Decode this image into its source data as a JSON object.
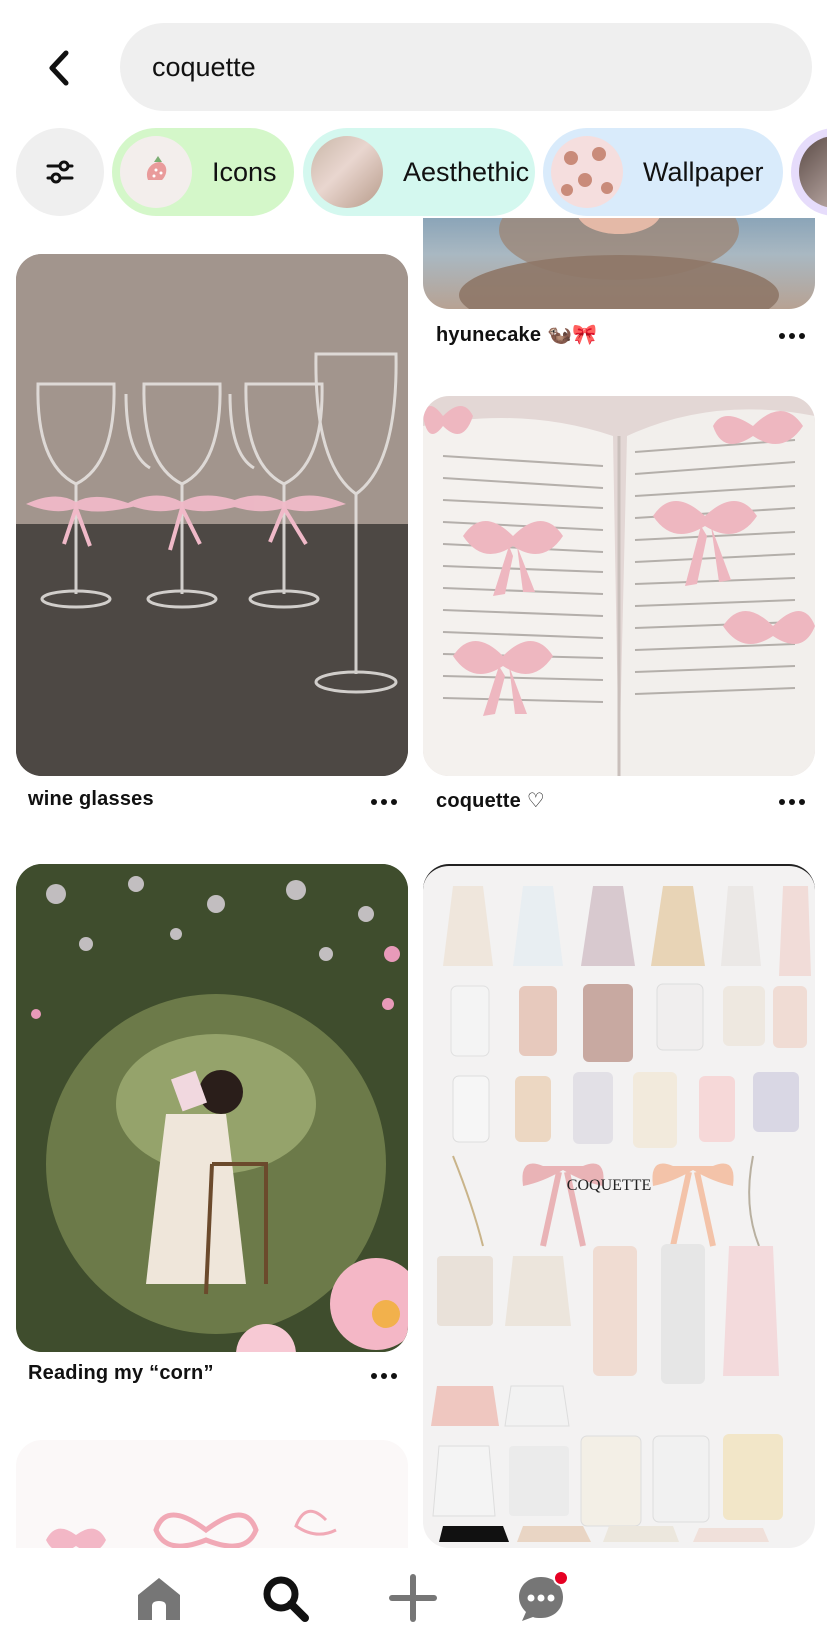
{
  "search": {
    "query": "coquette"
  },
  "chips": [
    {
      "label": "Icons",
      "bg": "#d4f7c9"
    },
    {
      "label": "Aesthethic",
      "bg": "#d4f8ef"
    },
    {
      "label": "Wallpaper",
      "bg": "#d9ebfb"
    }
  ],
  "pins": [
    {
      "title": "hyunecake 🦦🎀"
    },
    {
      "title": "wine glasses"
    },
    {
      "title": "coquette ♡"
    },
    {
      "title": "Reading my “corn”"
    }
  ],
  "collage_text": "COQUETTE",
  "colors": {
    "accent": "#e60023",
    "chip_bg": "#efefef"
  },
  "icons": {
    "back": "chevron-left-icon",
    "filter": "sliders-icon",
    "home": "home-icon",
    "search": "search-icon",
    "create": "plus-icon",
    "messages": "chat-bubble-icon"
  }
}
